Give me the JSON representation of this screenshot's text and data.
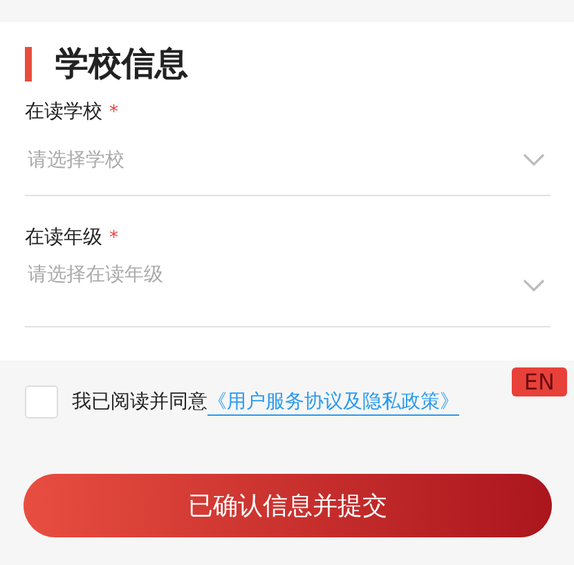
{
  "section_title": "学校信息",
  "fields": [
    {
      "label": "在读学校",
      "required_mark": "*",
      "placeholder": "请选择学校"
    },
    {
      "label": "在读年级",
      "required_mark": "*",
      "placeholder": "请选择在读年级"
    }
  ],
  "agreement": {
    "checked": false,
    "text": "我已阅读并同意",
    "link": "《用户服务协议及隐私政策》"
  },
  "language_badge": "EN",
  "submit_button": "已确认信息并提交"
}
